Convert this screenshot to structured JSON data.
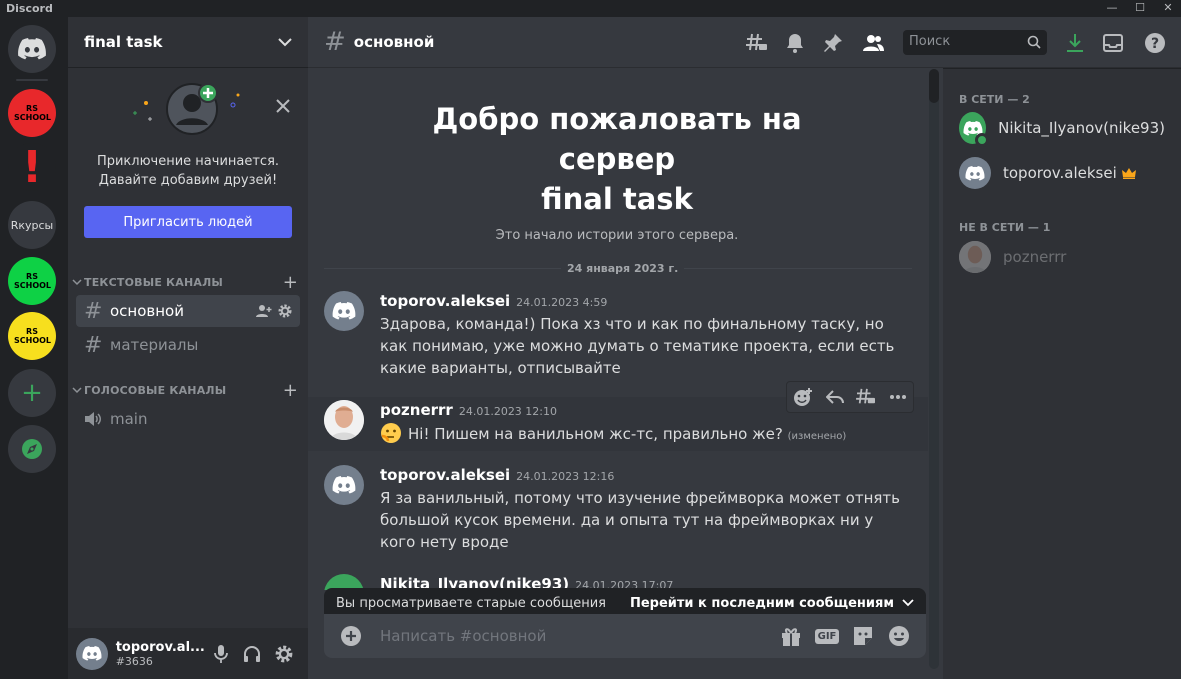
{
  "app": {
    "title": "Discord",
    "window_buttons": [
      "—",
      "☐",
      "✕"
    ]
  },
  "guilds": [
    {
      "name": "Discord Home"
    },
    {
      "label": "RS SCHOOL",
      "bg": "#e8282b"
    },
    {
      "label": "!",
      "bg": "#202225"
    },
    {
      "label": "Rкурсы",
      "bg": "#36393f"
    },
    {
      "label": "RS SCHOOL",
      "bg": "#0ed145"
    },
    {
      "label": "RS SCHOOL",
      "bg": "#f7df1e"
    },
    {
      "label": "+"
    },
    {
      "label": "explore"
    }
  ],
  "server": {
    "name": "final task"
  },
  "invite": {
    "line1": "Приключение начинается.",
    "line2": "Давайте добавим друзей!",
    "button": "Пригласить людей"
  },
  "categories": {
    "text": "ТЕКСТОВЫЕ КАНАЛЫ",
    "voice": "ГОЛОСОВЫЕ КАНАЛЫ"
  },
  "channels": {
    "text": [
      {
        "name": "основной"
      },
      {
        "name": "материалы"
      }
    ],
    "voice": [
      {
        "name": "main"
      }
    ]
  },
  "user": {
    "name": "toporov.al...",
    "tag": "#3636"
  },
  "header": {
    "channel": "основной",
    "search_placeholder": "Поиск"
  },
  "welcome": {
    "line1": "Добро пожаловать на",
    "line2": "сервер",
    "line3": "final task",
    "subtitle": "Это начало истории этого сервера."
  },
  "date_divider": "24 января 2023 г.",
  "messages": [
    {
      "author": "toporov.aleksei",
      "time": "24.01.2023 4:59",
      "text": "Здарова, команда!) Пока хз что и как по финальному таску, но как понимаю, уже можно думать о тематике проекта, если есть какие варианты, отписывайте"
    },
    {
      "author": "poznerrr",
      "time": "24.01.2023 12:10",
      "text": "Hi! Пишем на ванильном жс-тс, правильно же?",
      "edited": "(изменено)"
    },
    {
      "author": "toporov.aleksei",
      "time": "24.01.2023 12:16",
      "text": "Я за ванильный, потому что изучение фреймворка может отнять большой кусок времени. да и опыта тут на фреймворках ни у кого нету вроде"
    },
    {
      "author": "Nikita_Ilyanov(nike93)",
      "time": "24.01.2023 17:07",
      "text": ""
    }
  ],
  "banner": {
    "left": "Вы просматриваете старые сообщения",
    "right": "Перейти к последним сообщениям"
  },
  "composer": {
    "placeholder": "Написать #основной",
    "gif": "GIF"
  },
  "members": {
    "online_header": "В СЕТИ — 2",
    "offline_header": "НЕ В СЕТИ — 1",
    "online": [
      {
        "name": "Nikita_Ilyanov(nike93)"
      },
      {
        "name": "toporov.aleksei"
      }
    ],
    "offline": [
      {
        "name": "poznerrr"
      }
    ]
  },
  "colors": {
    "accent": "#5865f2",
    "online": "#3ba55c",
    "green_action": "#3ba55c"
  }
}
